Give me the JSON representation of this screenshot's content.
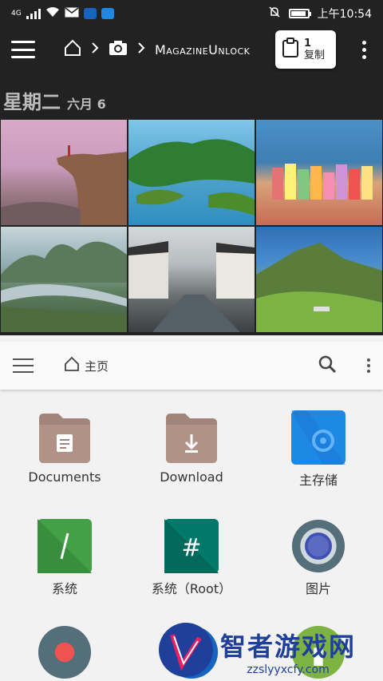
{
  "status_bar": {
    "network": "4G",
    "time": "上午10:54"
  },
  "toolbar": {
    "path_current": "MagazineUnlock",
    "clipboard": {
      "count": "1",
      "action": "复制"
    }
  },
  "gallery": {
    "date_day": "星期二",
    "date_month": "六月 6"
  },
  "appbar": {
    "title": "主页"
  },
  "tiles": [
    {
      "label": "Documents",
      "icon": "folder-document-icon"
    },
    {
      "label": "Download",
      "icon": "folder-download-icon"
    },
    {
      "label": "主存储",
      "icon": "storage-icon"
    },
    {
      "label": "系统",
      "icon": "system-icon",
      "glyph": "/"
    },
    {
      "label": "系统（Root）",
      "icon": "root-icon",
      "glyph": "#"
    },
    {
      "label": "图片",
      "icon": "images-icon"
    }
  ],
  "watermark": {
    "title": "智者游戏网",
    "url": "zzslyyxcfy.com"
  },
  "colors": {
    "dark_bar": "#222222",
    "folder": "#a2857a",
    "storage_blue": "#1e88e5",
    "system_green": "#43a047",
    "root_teal": "#00796b",
    "images_indigo": "#3f51b5",
    "record_red": "#ef5350"
  }
}
